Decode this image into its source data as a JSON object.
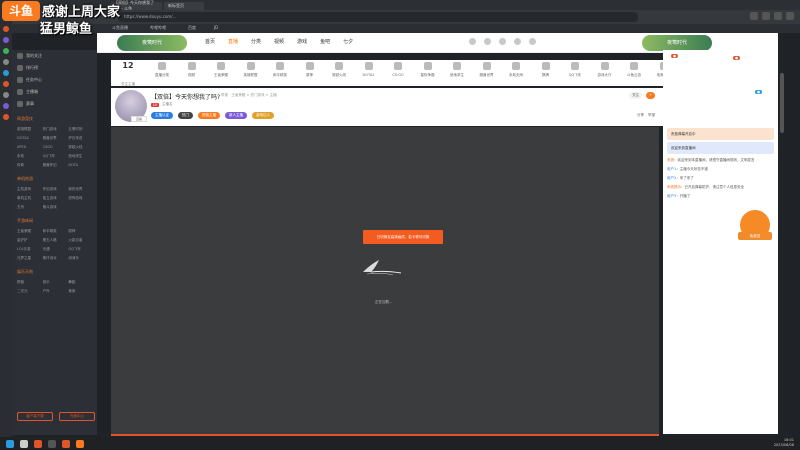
{
  "overlay": {
    "logo": "斗鱼",
    "line1": "感谢上周大家",
    "line2": "猛男鲸鱼"
  },
  "browser": {
    "tabs": [
      "【双倍】今天你想我了吗? - 斗鱼",
      "新标签页"
    ],
    "url": "https://www.douyu.com/...",
    "bookmarks": [
      "斗鱼直播",
      "哔哩哔哩",
      "百度",
      "JD"
    ]
  },
  "header": {
    "deco_left": "夜莺时代",
    "deco_right": "夜莺时代",
    "nav": [
      "首页",
      "直播",
      "分类",
      "视频",
      "游戏",
      "鱼吧",
      "七夕"
    ],
    "active_index": 1
  },
  "categories": {
    "first_value": "12",
    "first_label": "关注主播",
    "items": [
      "直播分类",
      "视频",
      "王者荣耀",
      "英雄联盟",
      "和平精英",
      "原神",
      "穿越火线",
      "DOTA2",
      "CS:GO",
      "星际争霸",
      "绝地求生",
      "魔兽世界",
      "永劫无间",
      "棋牌",
      "QQ飞车",
      "游戏大厅",
      "斗鱼云游",
      "电竞赛事"
    ]
  },
  "sidebar": {
    "top": [
      "我的关注",
      "排行榜",
      "任务中心",
      "主播端",
      "赛事"
    ],
    "sections": [
      {
        "title": "网游竞技",
        "items": [
          "英雄联盟",
          "热门游戏",
          "五黑时刻",
          "DOTA2",
          "魔兽世界",
          "炉石传说",
          "APEX",
          "CSGO",
          "穿越火线",
          "永劫",
          "QQ飞车",
          "绝地求生",
          "传奇",
          "魔兽怀旧",
          "DOTA"
        ]
      },
      {
        "title": "单机热游",
        "items": [
          "主机游戏",
          "怀旧游戏",
          "我的世界",
          "单机主机",
          "独立游戏",
          "恐怖游戏",
          "方舟",
          "格斗游戏"
        ]
      },
      {
        "title": "手游休闲",
        "items": [
          "王者荣耀",
          "和平精英",
          "原神",
          "金铲铲",
          "第五人格",
          "火影忍者",
          "LOL手游",
          "光遇",
          "QQ飞车",
          "元梦之星",
          "蛋仔派对",
          "消消乐"
        ]
      },
      {
        "title": "娱乐天地",
        "items": [
          "颜值",
          "音乐",
          "舞蹈",
          "二次元",
          "户外",
          "美食"
        ]
      }
    ],
    "btn1": "客户端下载",
    "btn2": "充值中心"
  },
  "room": {
    "title": "【双倍】今天你想我了吗?",
    "meta": "举报 · 王者荣耀 > 热门游戏 > 主播",
    "avatar_tag": "直播",
    "badge": "LV",
    "anchor": "主播名",
    "tags": [
      "主播认证",
      "热门",
      "颜值主播",
      "新人主播",
      "游戏达人"
    ],
    "follow": "关注",
    "share": "分享",
    "report": "举报"
  },
  "player": {
    "notice": "已切换至高清画质，若卡顿可切换",
    "loading": "正在加载..."
  },
  "chat": {
    "banner1": "贵族弹幕开启中",
    "banner2": "欢迎来到直播间",
    "lines": [
      {
        "name": "系统",
        "text": "欢迎来到本直播间，请遵守直播间规则，文明发言"
      },
      {
        "name": "用户1",
        "text": "主播今天状态不错"
      },
      {
        "name": "用户2",
        "text": "来了来了"
      },
      {
        "name": "系统提示",
        "text": "已开启弹幕防护，请注意个人信息安全"
      },
      {
        "name": "用户3",
        "text": "开播了"
      }
    ],
    "gift_label": "免费送"
  },
  "taskbar": {
    "time": "16:01",
    "date": "2023/08/08"
  },
  "colors": {
    "accent": "#f97a1f",
    "player_bg": "#3b3c3e",
    "notice": "#f45b21"
  }
}
